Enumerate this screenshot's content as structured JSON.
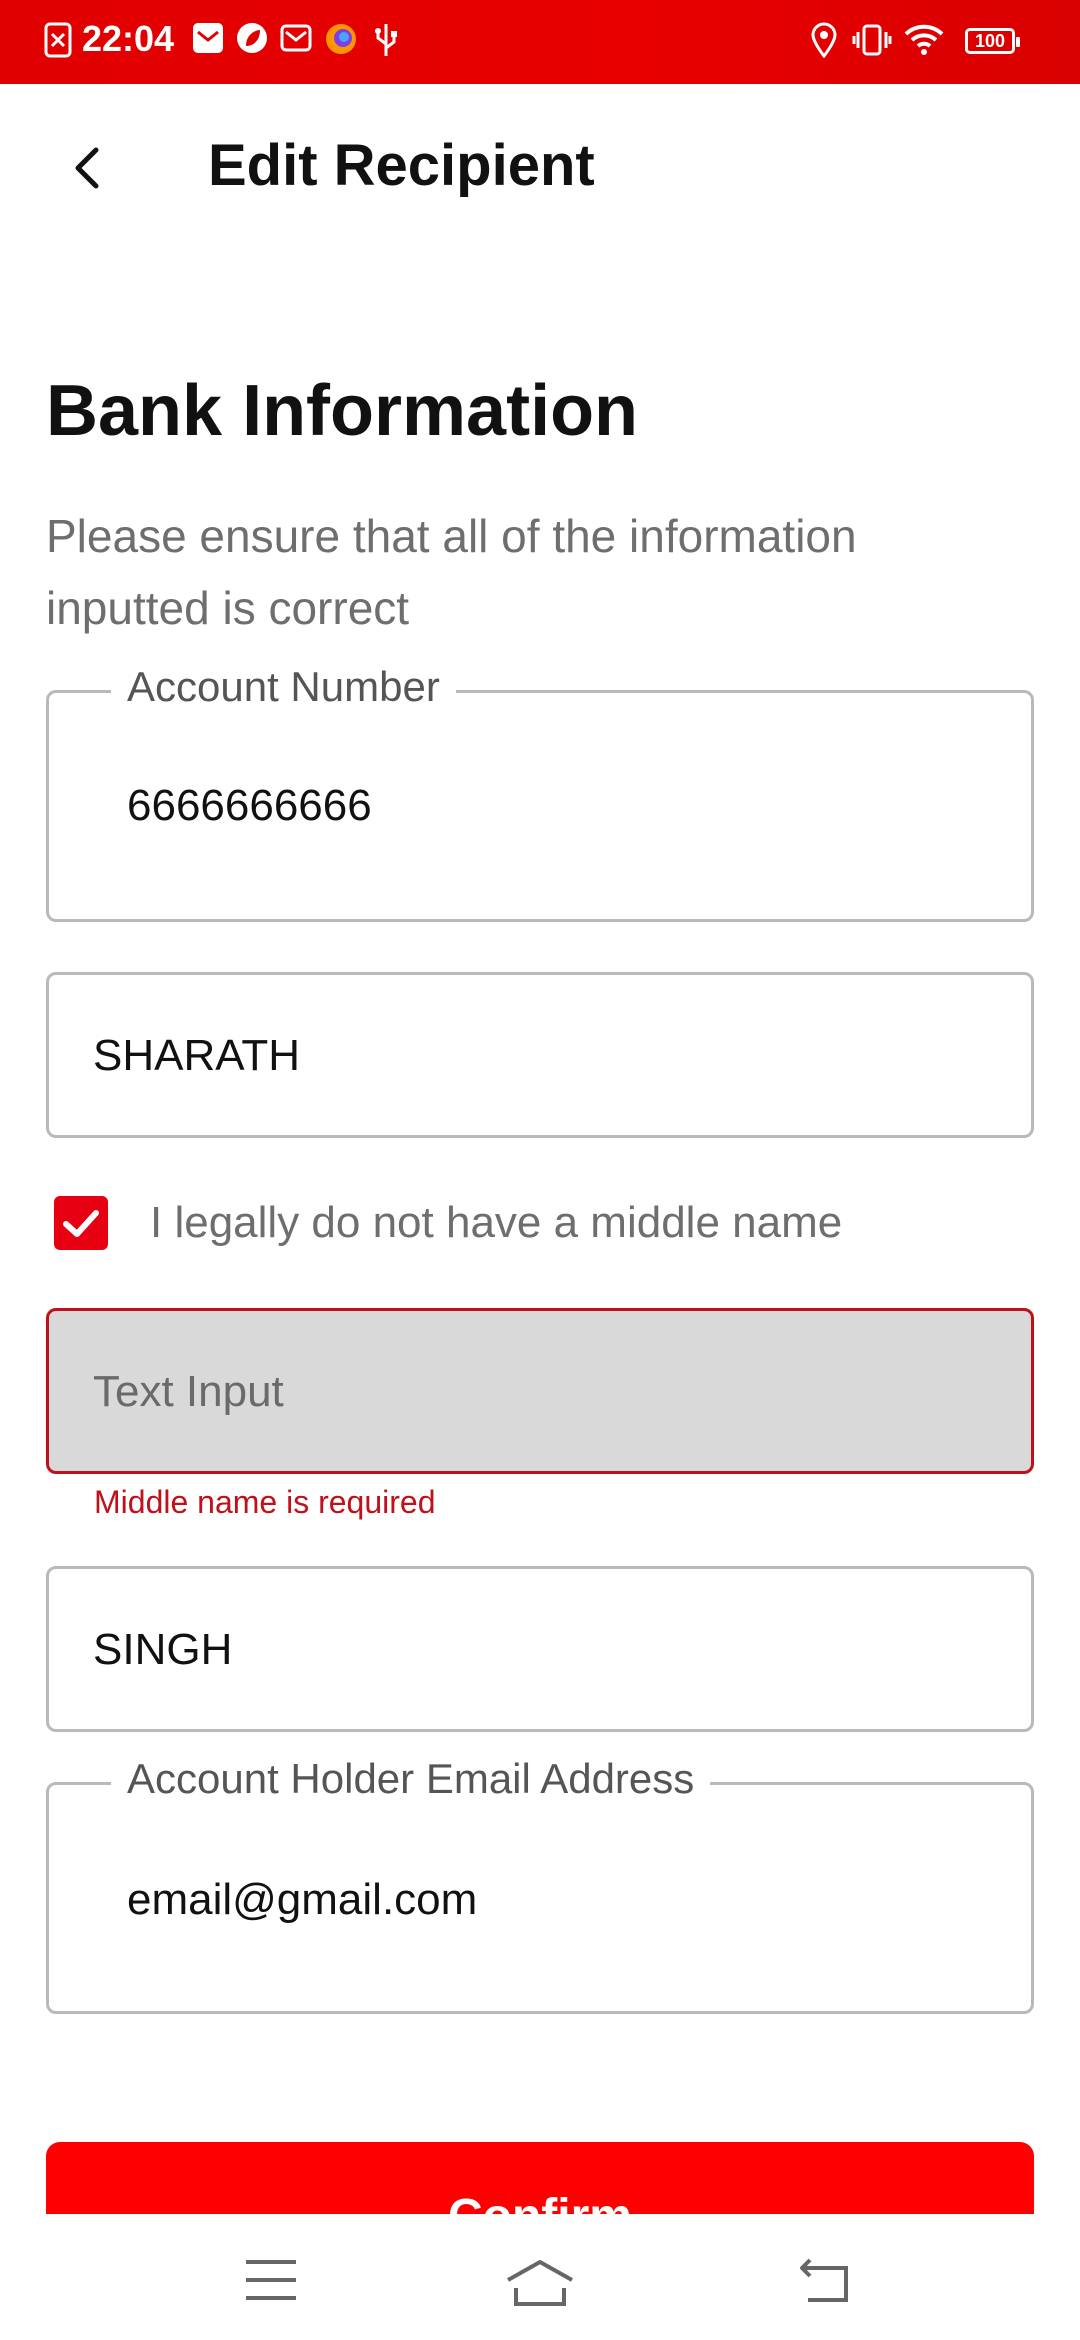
{
  "status_bar": {
    "time": "22:04",
    "battery": "100",
    "left_icons": [
      "close-box-icon",
      "mail-icon",
      "leaf-icon",
      "mail-outline-icon",
      "firefox-icon",
      "usb-icon"
    ],
    "right_icons": [
      "location-icon",
      "vibrate-icon",
      "wifi-icon",
      "battery-icon"
    ]
  },
  "header": {
    "title": "Edit Recipient",
    "back_icon": "chevron-left-icon"
  },
  "section": {
    "title": "Bank Information",
    "description": "Please ensure that all of the information inputted is correct"
  },
  "fields": {
    "account_number": {
      "label": "Account Number",
      "value": "6666666666"
    },
    "first_name": {
      "value": "SHARATH"
    },
    "middle_name": {
      "placeholder": "Text Input",
      "error": "Middle name is required"
    },
    "last_name": {
      "value": "SINGH"
    },
    "email": {
      "label": "Account Holder Email Address",
      "value": "email@gmail.com"
    }
  },
  "checkbox": {
    "label": "I legally do not have a middle name",
    "checked": true
  },
  "confirm_button": {
    "label": "Confirm"
  },
  "colors": {
    "accent": "#ff0000",
    "status_bar": "#e00000",
    "error": "#c0101a"
  },
  "navigation": {
    "icons": [
      "menu-icon",
      "home-icon",
      "back-icon"
    ]
  }
}
